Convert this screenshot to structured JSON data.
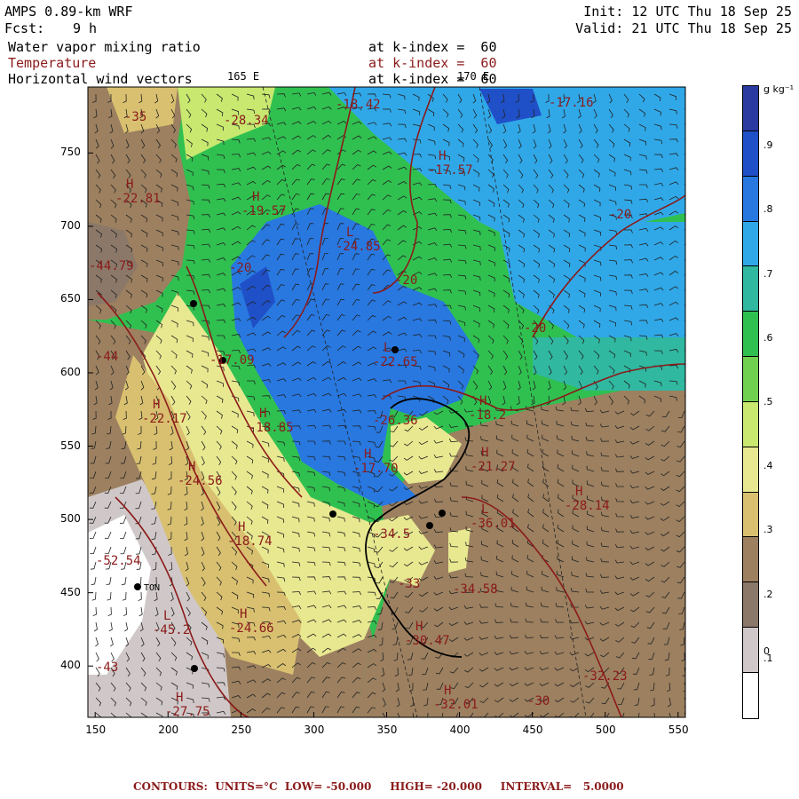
{
  "header": {
    "model": "AMPS 0.89-km WRF",
    "forecast_label": "Fcst:",
    "forecast_value": "9 h",
    "init": "Init: 12 UTC Thu 18 Sep 25",
    "valid": "Valid: 21 UTC Thu 18 Sep 25",
    "fields": [
      {
        "name": "Water vapor mixing ratio",
        "level": "at k-index =  60",
        "color": "#000000"
      },
      {
        "name": "Temperature",
        "level": "at k-index =  60",
        "color": "#8b1a1a"
      },
      {
        "name": "Horizontal wind vectors",
        "level": "at k-index =  60",
        "color": "#000000"
      }
    ]
  },
  "map": {
    "x_ticks": [
      "150",
      "200",
      "250",
      "300",
      "350",
      "400",
      "450",
      "500",
      "550"
    ],
    "y_ticks": [
      "750",
      "700",
      "650",
      "600",
      "550",
      "500",
      "450",
      "400"
    ],
    "lon_labels": [
      "165 E",
      "170 E"
    ],
    "temperature_labels": [
      {
        "text": "-18.42",
        "kind": ""
      },
      {
        "text": "-17.16",
        "kind": ""
      },
      {
        "text": "-17.57",
        "kind": "H"
      },
      {
        "text": "-19.57",
        "kind": "H"
      },
      {
        "text": "-24.85",
        "kind": "L"
      },
      {
        "text": "-22.65",
        "kind": "L"
      },
      {
        "text": "-20",
        "kind": ""
      },
      {
        "text": "-20",
        "kind": ""
      },
      {
        "text": "-20",
        "kind": ""
      },
      {
        "text": "-20",
        "kind": ""
      },
      {
        "text": "-17.09",
        "kind": ""
      },
      {
        "text": "-18.85",
        "kind": "H"
      },
      {
        "text": "-17.70",
        "kind": "H"
      },
      {
        "text": "-22.81",
        "kind": "H"
      },
      {
        "text": "-28.34",
        "kind": ""
      },
      {
        "text": "-35",
        "kind": ""
      },
      {
        "text": "-44.79",
        "kind": ""
      },
      {
        "text": "-22.17",
        "kind": "H"
      },
      {
        "text": "-24.56",
        "kind": "H"
      },
      {
        "text": "-18.74",
        "kind": "H"
      },
      {
        "text": "-52.54",
        "kind": ""
      },
      {
        "text": "-45.2",
        "kind": "L"
      },
      {
        "text": "-24.66",
        "kind": "H"
      },
      {
        "text": "-34.5",
        "kind": ""
      },
      {
        "text": "-36.01",
        "kind": "L"
      },
      {
        "text": "-28.14",
        "kind": "H"
      },
      {
        "text": "-34.58",
        "kind": ""
      },
      {
        "text": "-30.47",
        "kind": "H"
      },
      {
        "text": "-32.01",
        "kind": "H"
      },
      {
        "text": "-32.23",
        "kind": ""
      },
      {
        "text": "-30",
        "kind": ""
      },
      {
        "text": "-27.75",
        "kind": "H"
      },
      {
        "text": "-21.27",
        "kind": "H"
      },
      {
        "text": "-26.36",
        "kind": ""
      },
      {
        "text": "-18.2",
        "kind": "H"
      },
      {
        "text": "-33",
        "kind": ""
      },
      {
        "text": "-43",
        "kind": ""
      },
      {
        "text": "-44",
        "kind": ""
      }
    ],
    "station_label": "TON"
  },
  "colorbar": {
    "unit": "g kg⁻¹",
    "labels": [
      ".9",
      ".8",
      ".7",
      ".6",
      ".5",
      ".4",
      ".3",
      ".2",
      ".1",
      "0"
    ],
    "colors": [
      "#2a3aa0",
      "#2050c8",
      "#2878e0",
      "#30a8e8",
      "#30b8a0",
      "#30c050",
      "#70d050",
      "#c8e870",
      "#e8e890",
      "#d8c070",
      "#9c8060",
      "#8c7868",
      "#d0c8c8",
      "#ffffff"
    ]
  },
  "footer": {
    "text": "CONTOURS:  UNITS=°C  LOW= -50.000     HIGH= -20.000     INTERVAL=   5.0000"
  }
}
